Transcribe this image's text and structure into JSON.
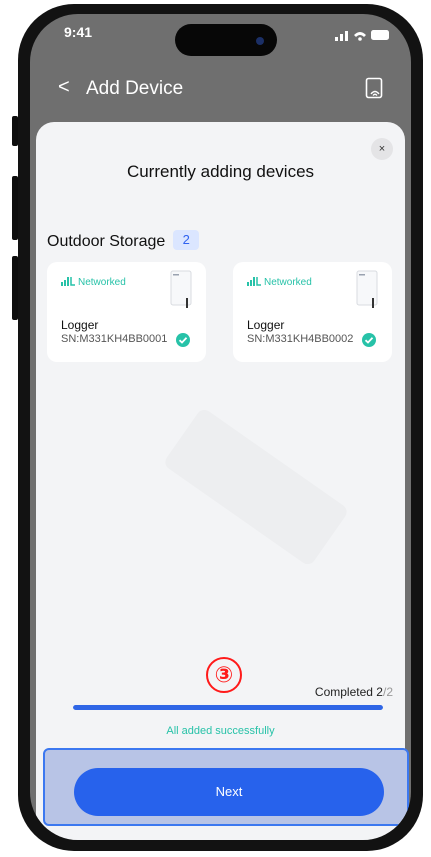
{
  "status_bar": {
    "time": "9:41"
  },
  "nav": {
    "back_icon": "chevron-left-icon",
    "title": "Add Device",
    "scan_icon": "scan-device-icon"
  },
  "sheet": {
    "close_label": "×",
    "title": "Currently adding devices",
    "group": {
      "name": "Outdoor Storage",
      "count": "2"
    },
    "devices": [
      {
        "status": "Networked",
        "name": "Logger",
        "sn": "SN:M331KH4BB0001"
      },
      {
        "status": "Networked",
        "name": "Logger",
        "sn": "SN:M331KH4BB0002"
      }
    ],
    "step_marker": "③",
    "progress": {
      "label": "Completed",
      "done": "2",
      "total": "/2",
      "fraction": 1.0
    },
    "success_text": "All added successfully",
    "next_label": "Next"
  },
  "colors": {
    "accent": "#2762ec",
    "success": "#27c2a8",
    "annotation": "#ff1a1a"
  }
}
